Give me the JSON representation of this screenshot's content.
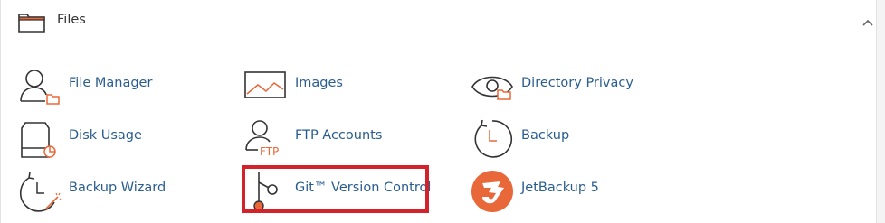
{
  "section": {
    "title": "Files",
    "collapse_icon": "chevron-up-icon"
  },
  "items": [
    {
      "label": "File Manager",
      "icon": "file-manager-icon"
    },
    {
      "label": "Images",
      "icon": "images-icon"
    },
    {
      "label": "Directory Privacy",
      "icon": "directory-privacy-icon"
    },
    {
      "label": "Disk Usage",
      "icon": "disk-usage-icon"
    },
    {
      "label": "FTP Accounts",
      "icon": "ftp-accounts-icon"
    },
    {
      "label": "Backup",
      "icon": "backup-icon"
    },
    {
      "label": "Backup Wizard",
      "icon": "backup-wizard-icon"
    },
    {
      "label": "Git™ Version Control",
      "icon": "git-version-control-icon",
      "highlighted": true
    },
    {
      "label": "JetBackup 5",
      "icon": "jetbackup-icon"
    }
  ],
  "ftp_icon_text": "FTP",
  "colors": {
    "link": "#2a5d8f",
    "accent": "#e8683a",
    "icon_stroke": "#333333",
    "highlight": "#d3222a"
  }
}
